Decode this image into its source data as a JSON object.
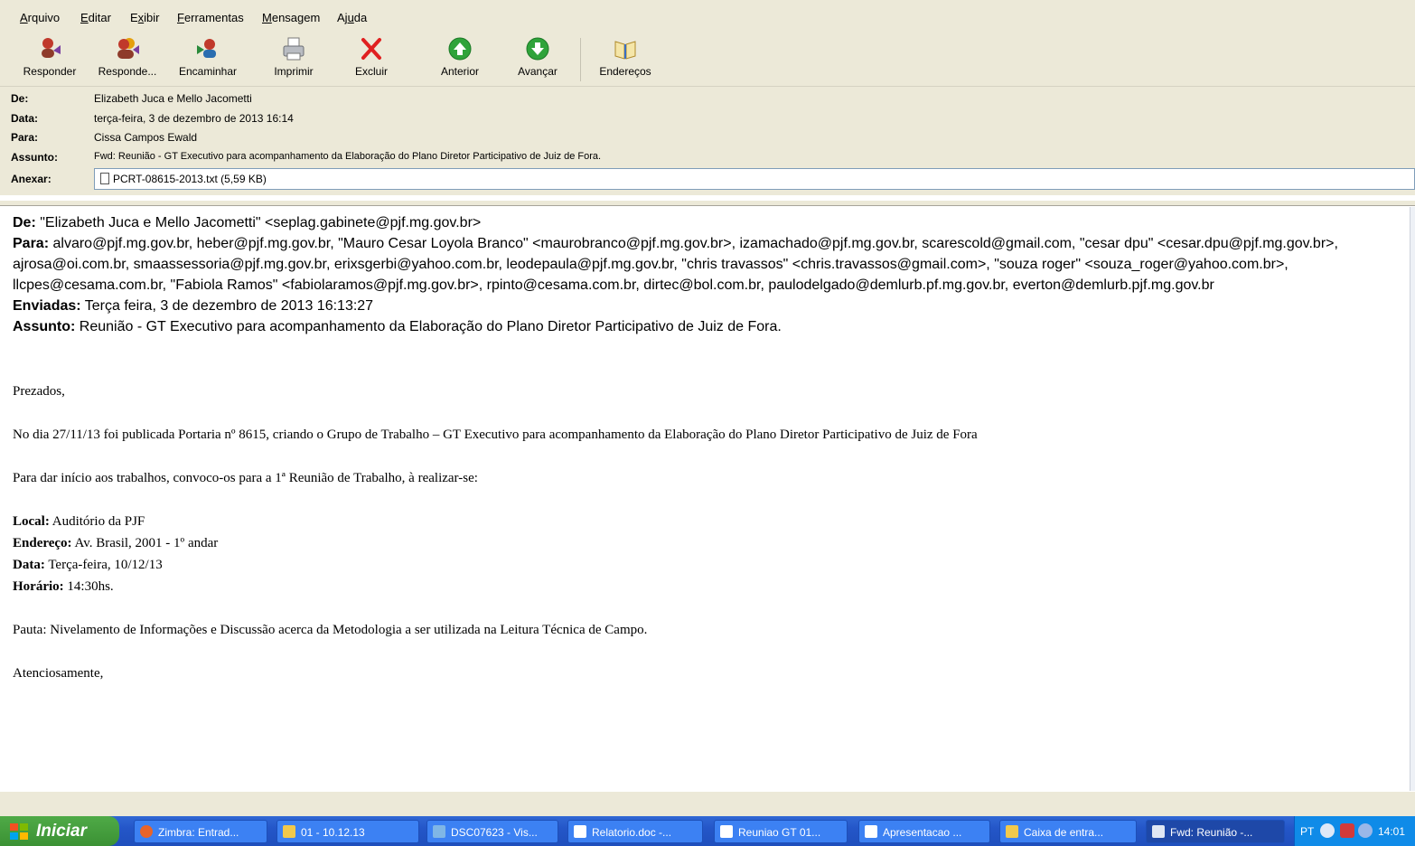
{
  "menu": [
    {
      "pre": "",
      "u": "A",
      "post": "rquivo"
    },
    {
      "pre": "",
      "u": "E",
      "post": "ditar"
    },
    {
      "pre": "E",
      "u": "x",
      "post": "ibir"
    },
    {
      "pre": "",
      "u": "F",
      "post": "erramentas"
    },
    {
      "pre": "",
      "u": "M",
      "post": "ensagem"
    },
    {
      "pre": "Aj",
      "u": "u",
      "post": "da"
    }
  ],
  "toolbar": {
    "reply": "Responder",
    "reply_all": "Responde...",
    "forward": "Encaminhar",
    "print": "Imprimir",
    "delete": "Excluir",
    "previous": "Anterior",
    "next": "Avançar",
    "addresses": "Endereços"
  },
  "header": {
    "from_label": "De:",
    "from": "Elizabeth Juca e Mello Jacometti",
    "date_label": "Data:",
    "date": "terça-feira, 3 de dezembro de 2013 16:14",
    "to_label": "Para:",
    "to": "Cissa Campos Ewald",
    "subject_label": "Assunto:",
    "subject": "Fwd: Reunião - GT Executivo para acompanhamento da Elaboração do Plano Diretor Participativo de Juiz de Fora.",
    "attach_label": "Anexar:",
    "attachment": "PCRT-08615-2013.txt (5,59 KB)"
  },
  "forwarded": {
    "from_label": "De:",
    "from": "\"Elizabeth Juca e Mello Jacometti\" <seplag.gabinete@pjf.mg.gov.br>",
    "to_label": "Para:",
    "to": "alvaro@pjf.mg.gov.br, heber@pjf.mg.gov.br, \"Mauro Cesar Loyola Branco\" <maurobranco@pjf.mg.gov.br>, izamachado@pjf.mg.gov.br, scarescold@gmail.com, \"cesar dpu\" <cesar.dpu@pjf.mg.gov.br>, ajrosa@oi.com.br, smaassessoria@pjf.mg.gov.br, erixsgerbi@yahoo.com.br, leodepaula@pjf.mg.gov.br, \"chris travassos\" <chris.travassos@gmail.com>, \"souza roger\" <souza_roger@yahoo.com.br>, llcpes@cesama.com.br, \"Fabiola Ramos\" <fabiolaramos@pjf.mg.gov.br>, rpinto@cesama.com.br, dirtec@bol.com.br, paulodelgado@demlurb.pf.mg.gov.br, everton@demlurb.pjf.mg.gov.br",
    "sent_label": "Enviadas:",
    "sent": "Terça feira, 3 de dezembro de 2013 16:13:27",
    "subject_label": "Assunto:",
    "subject": "Reunião - GT Executivo para acompanhamento da Elaboração do Plano Diretor Participativo de Juiz de Fora."
  },
  "message": {
    "greeting": "Prezados,",
    "p1": "No dia 27/11/13 foi publicada Portaria nº 8615, criando o Grupo de Trabalho – GT Executivo para acompanhamento da Elaboração do Plano Diretor Participativo de Juiz de Fora",
    "p2": "Para dar início aos trabalhos, convoco-os para a 1ª Reunião de Trabalho, à realizar-se:",
    "local_label": "Local:",
    "local": "Auditório da PJF",
    "address_label": "Endereço:",
    "address": "Av. Brasil, 2001 - 1º andar",
    "date_label": "Data:",
    "date": "Terça-feira, 10/12/13",
    "time_label": "Horário:",
    "time": "14:30hs.",
    "agenda": "Pauta: Nivelamento de Informações e Discussão acerca da Metodologia a ser utilizada na Leitura Técnica de Campo.",
    "closing": "Atenciosamente,"
  },
  "taskbar": {
    "start": "Iniciar",
    "tasks": [
      "Zimbra: Entrad...",
      "01 - 10.12.13",
      "DSC07623 - Vis...",
      "Relatorio.doc -...",
      "Reuniao GT 01...",
      "Apresentacao ...",
      "Caixa de entra...",
      "Fwd: Reunião -..."
    ],
    "lang": "PT",
    "clock": "14:01"
  },
  "colors": {
    "chrome": "#ece9d8",
    "taskbar": "#2456c8",
    "start": "#3b9134",
    "delete": "#e02020",
    "nav_green": "#2fa33a"
  }
}
